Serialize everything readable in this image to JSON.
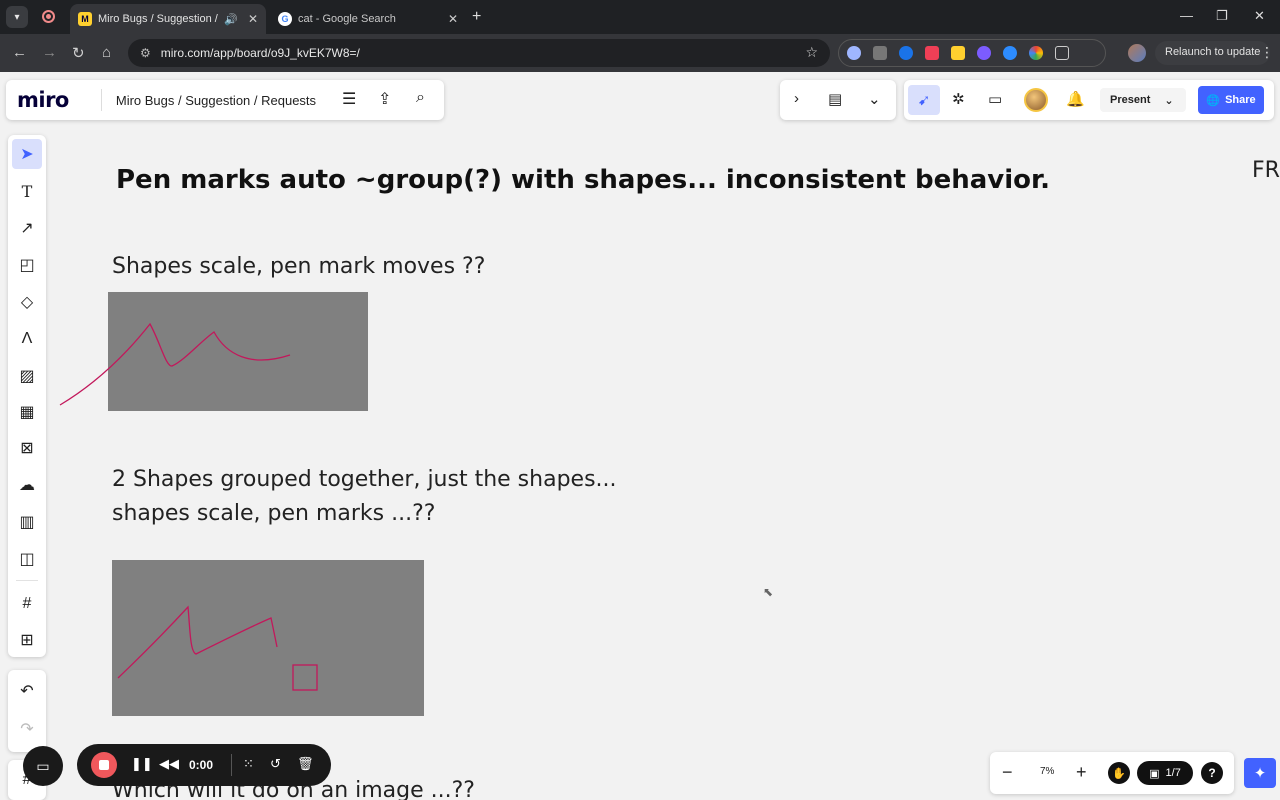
{
  "browser": {
    "tabs": [
      {
        "title": "Miro Bugs / Suggestion / Requests",
        "active": true,
        "icon": "miro-favicon"
      },
      {
        "title": "cat - Google Search",
        "active": false,
        "icon": "google-favicon"
      }
    ],
    "url": "miro.com/app/board/o9J_kvEK7W8=/",
    "relaunch_label": "Relaunch to update"
  },
  "miro": {
    "logo": "miro",
    "board_title": "Miro Bugs / Suggestion / Requests",
    "present_label": "Present",
    "share_label": "Share",
    "zoom": "7%",
    "pages": "1/7",
    "help": "?"
  },
  "recorder": {
    "time": "0:00"
  },
  "canvas": {
    "heading": "Pen marks auto ~group(?) with shapes... inconsistent behavior.",
    "section1": "Shapes scale, pen mark moves ??",
    "section2_line1": "2 Shapes grouped together, just the shapes...",
    "section2_line2": "shapes scale, pen marks ...??",
    "section3": "Which will it do on an image ...??",
    "edge_text": "FR"
  },
  "colors": {
    "accent": "#4262ff",
    "pen": "#c2185b",
    "shape_fill": "#808080",
    "record": "#f0585c"
  }
}
